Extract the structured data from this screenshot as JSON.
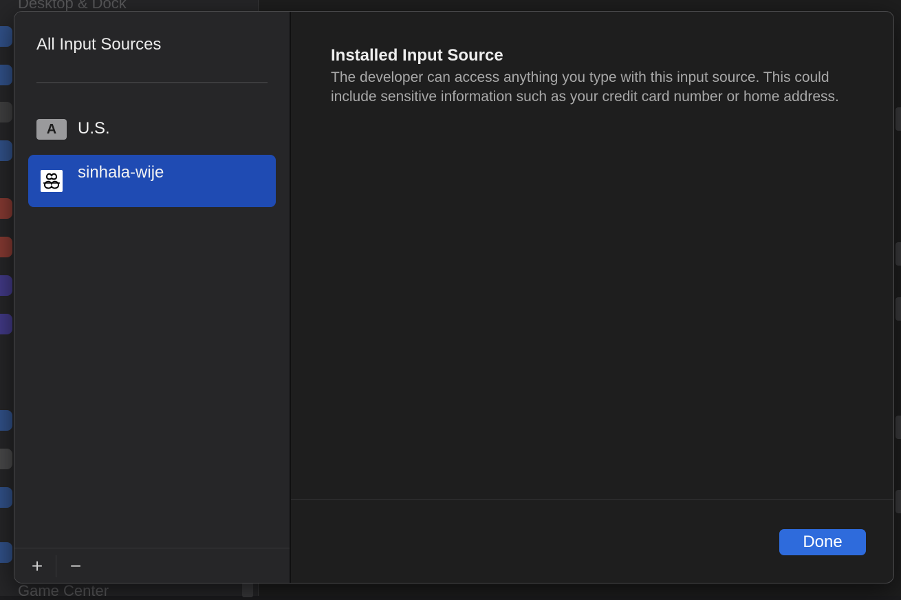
{
  "background_window": {
    "top_label": "Desktop & Dock",
    "bottom_label": "Game Center"
  },
  "sheet": {
    "sidebar": {
      "title": "All Input Sources",
      "sources": [
        {
          "badge": "A",
          "label": "U.S.",
          "selected": false
        },
        {
          "label": "sinhala-wije",
          "selected": true,
          "icon": "sinhala-letter-icon"
        }
      ],
      "add_symbol": "+",
      "remove_symbol": "−"
    },
    "detail": {
      "title": "Installed Input Source",
      "description": "The developer can access anything you type with this input source. This could include sensitive information such as your credit card number or home address."
    },
    "done_label": "Done"
  },
  "colors": {
    "accent": "#2e6bdc",
    "selection": "#1f4bb3",
    "sheet_bg": "#1e1e1e",
    "sidebar_bg": "#262628"
  }
}
